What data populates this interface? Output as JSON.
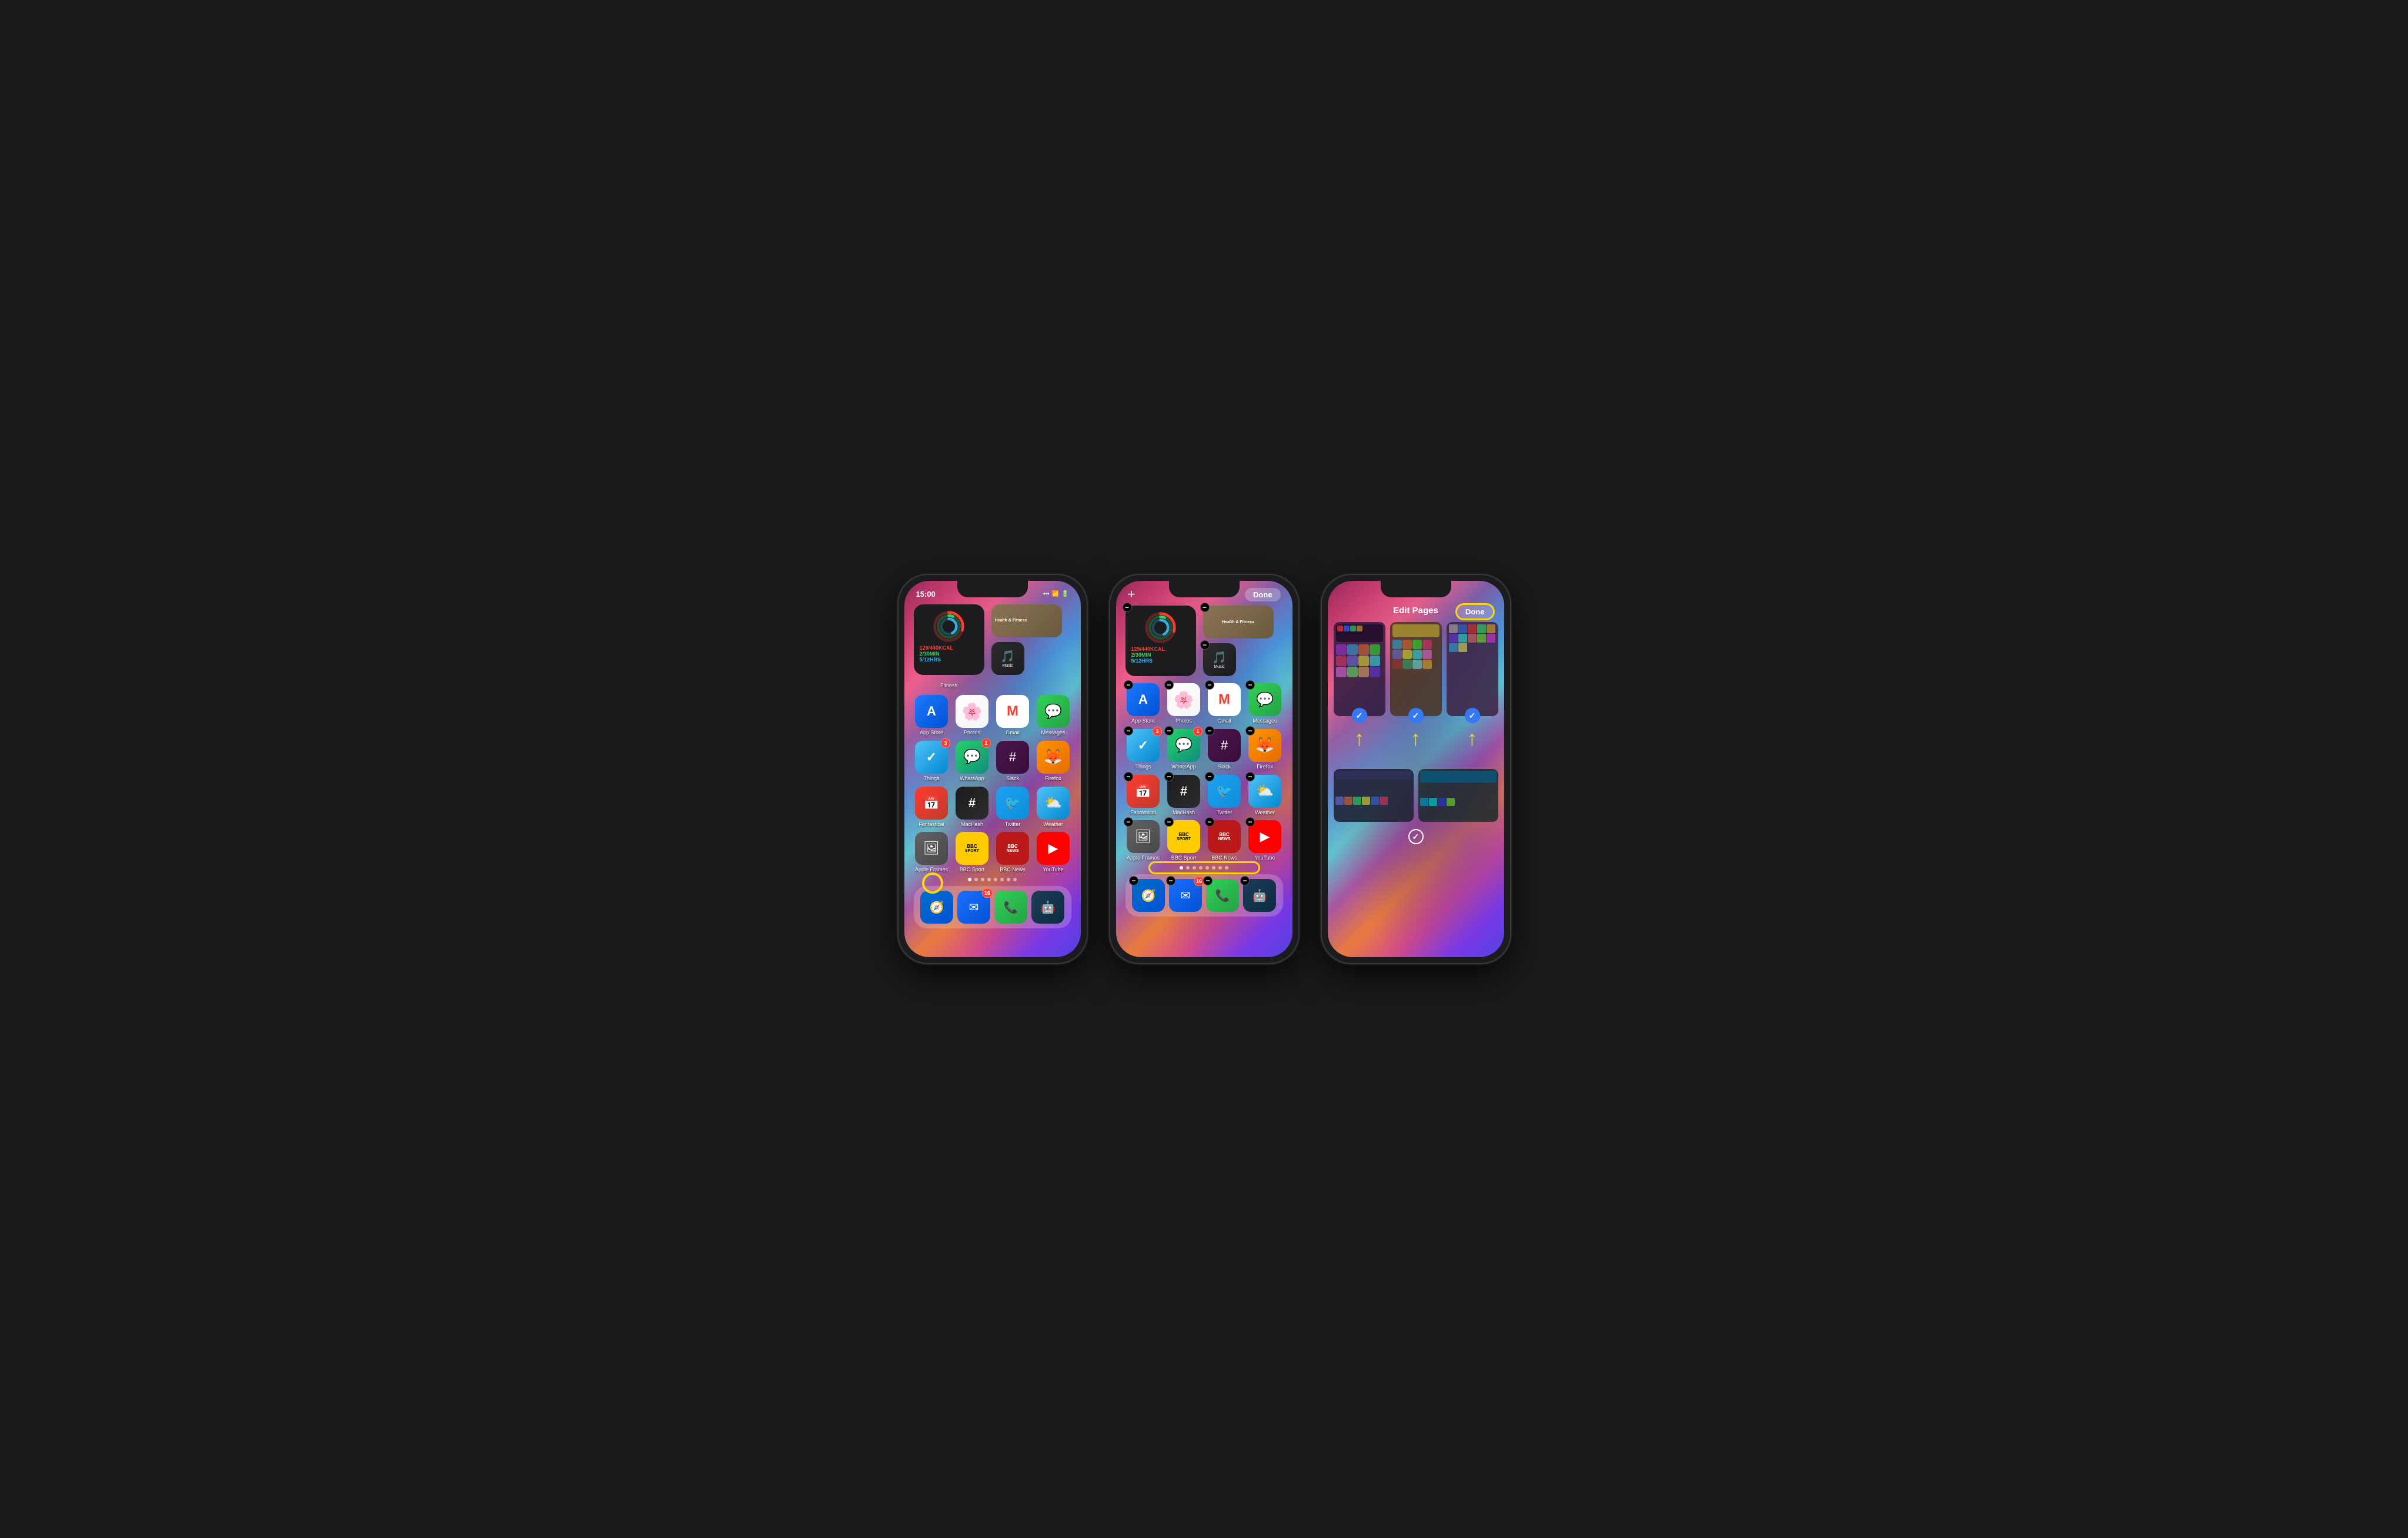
{
  "phones": [
    {
      "id": "phone1",
      "type": "normal",
      "status": {
        "time": "15:00",
        "signal": "●●●",
        "wifi": "WiFi",
        "battery": "▮▮▮"
      },
      "widgets": {
        "fitness": {
          "calories": "129/440KCAL",
          "exercise": "2/30MIN",
          "stand": "5/12HRS",
          "label": "Fitness"
        },
        "health": {
          "label": "Health & Fitness"
        },
        "music": {
          "label": "Music"
        }
      },
      "apps": [
        {
          "id": "appstore",
          "label": "App Store",
          "badge": null
        },
        {
          "id": "photos",
          "label": "Photos",
          "badge": null
        },
        {
          "id": "gmail",
          "label": "Gmail",
          "badge": null
        },
        {
          "id": "messages",
          "label": "Messages",
          "badge": null
        },
        {
          "id": "things",
          "label": "Things",
          "badge": "3"
        },
        {
          "id": "whatsapp",
          "label": "WhatsApp",
          "badge": "1"
        },
        {
          "id": "slack",
          "label": "Slack",
          "badge": null
        },
        {
          "id": "firefox",
          "label": "Firefox",
          "badge": null
        },
        {
          "id": "fantastical",
          "label": "Fantastical",
          "badge": null
        },
        {
          "id": "machash",
          "label": "MacHash",
          "badge": null
        },
        {
          "id": "twitter",
          "label": "Twitter",
          "badge": null
        },
        {
          "id": "weather",
          "label": "Weather",
          "badge": null
        },
        {
          "id": "appleframes",
          "label": "Apple Frames",
          "badge": null
        },
        {
          "id": "bbcsport",
          "label": "BBC Sport",
          "badge": null
        },
        {
          "id": "bbcnews",
          "label": "BBC News",
          "badge": null
        },
        {
          "id": "youtube",
          "label": "YouTube",
          "badge": null
        }
      ],
      "dock": [
        {
          "id": "safari",
          "label": "Safari",
          "badge": null
        },
        {
          "id": "mail",
          "label": "Mail",
          "badge": "16"
        },
        {
          "id": "phone",
          "label": "Phone",
          "badge": null
        },
        {
          "id": "tweetbot",
          "label": "Tweetbot",
          "badge": null
        }
      ],
      "dots": 8,
      "activeDot": 0,
      "highlight": "dot"
    },
    {
      "id": "phone2",
      "type": "jiggle",
      "status": {
        "time": "15:00",
        "signal": "●●●",
        "wifi": "WiFi",
        "battery": "▮▮▮"
      },
      "header": {
        "plus": "+",
        "done": "Done"
      },
      "apps": [
        {
          "id": "appstore",
          "label": "App Store",
          "badge": null
        },
        {
          "id": "photos",
          "label": "Photos",
          "badge": null
        },
        {
          "id": "gmail",
          "label": "Gmail",
          "badge": null
        },
        {
          "id": "messages",
          "label": "Messages",
          "badge": null
        },
        {
          "id": "things",
          "label": "Things",
          "badge": "3"
        },
        {
          "id": "whatsapp",
          "label": "WhatsApp",
          "badge": "1"
        },
        {
          "id": "slack",
          "label": "Slack",
          "badge": null
        },
        {
          "id": "firefox",
          "label": "Firefox",
          "badge": null
        },
        {
          "id": "fantastical",
          "label": "Fantastical",
          "badge": null
        },
        {
          "id": "machash",
          "label": "MacHash",
          "badge": null
        },
        {
          "id": "twitter",
          "label": "Twitter",
          "badge": null
        },
        {
          "id": "weather",
          "label": "Weather",
          "badge": null
        },
        {
          "id": "appleframes",
          "label": "Apple Frames",
          "badge": null
        },
        {
          "id": "bbcsport",
          "label": "BBC Sport",
          "badge": null
        },
        {
          "id": "bbcnews",
          "label": "BBC News",
          "badge": null
        },
        {
          "id": "youtube",
          "label": "YouTube",
          "badge": null
        }
      ],
      "dock": [
        {
          "id": "safari",
          "label": "Safari",
          "badge": null
        },
        {
          "id": "mail",
          "label": "Mail",
          "badge": "16"
        },
        {
          "id": "phone",
          "label": "Phone",
          "badge": null
        },
        {
          "id": "tweetbot",
          "label": "Tweetbot",
          "badge": null
        }
      ],
      "dots": 8,
      "activeDot": 0,
      "highlight": "dots"
    },
    {
      "id": "phone3",
      "type": "editpages",
      "title": "Edit Pages",
      "done": "Done",
      "pages": [
        {
          "checked": true,
          "color": "#2d1b3d"
        },
        {
          "checked": true,
          "color": "#4a3520"
        },
        {
          "checked": true,
          "color": "#3d2040"
        }
      ],
      "pages_bottom": [
        {
          "checked": false,
          "color": "#1c1c2e"
        },
        {
          "checked": false,
          "color": "#1a2a2a"
        }
      ],
      "checkmark_bottom": true
    }
  ],
  "icons": {
    "appstore": "🅐",
    "photos": "🌸",
    "gmail": "M",
    "messages": "💬",
    "things": "✓",
    "whatsapp": "📱",
    "slack": "#",
    "firefox": "🦊",
    "fantastical": "📅",
    "machash": "#",
    "twitter": "🐦",
    "weather": "⛅",
    "appleframes": "🖼",
    "bbcsport": "BBC",
    "bbcnews": "BBC",
    "youtube": "▶",
    "safari": "🧭",
    "mail": "✉",
    "phone": "📞",
    "tweetbot": "🤖",
    "podcasts": "🎙",
    "settings": "⚙",
    "fitness": "🏃"
  }
}
